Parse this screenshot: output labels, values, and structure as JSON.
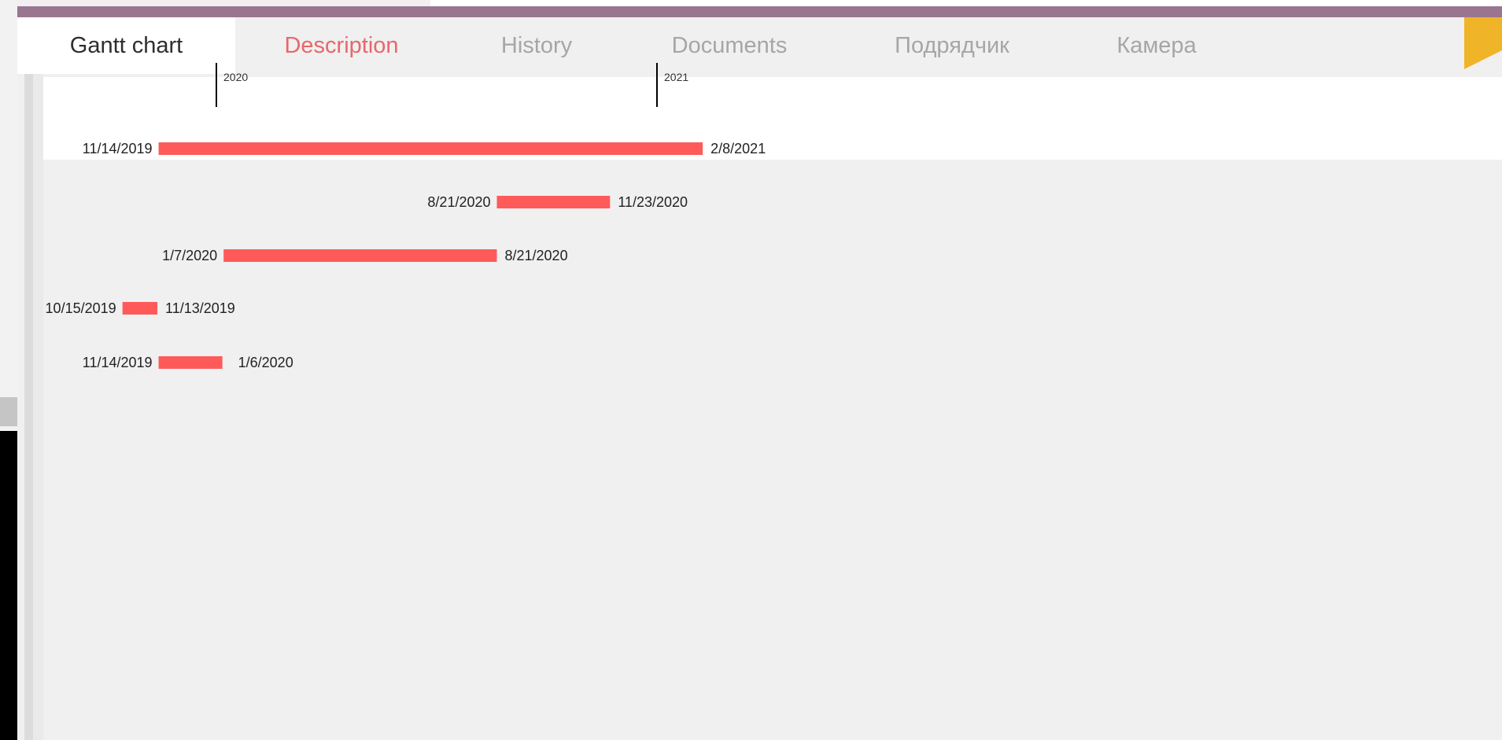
{
  "tabs": [
    {
      "label": "Gantt chart",
      "state": "active"
    },
    {
      "label": "Description",
      "state": "highlighted"
    },
    {
      "label": "History",
      "state": "normal"
    },
    {
      "label": "Documents",
      "state": "normal"
    },
    {
      "label": "Подрядчик",
      "state": "normal"
    },
    {
      "label": "Камера",
      "state": "normal"
    }
  ],
  "colors": {
    "bar": "#ff5a5a",
    "accent_bar": "#9a7590",
    "active_tab_text": "#2e2e2e",
    "highlight_tab_text": "#e8676b",
    "inactive_tab_text": "#a6a6a6",
    "corner_badge": "#f0b429"
  },
  "icons": {
    "corner": "corner-triangle-badge-icon"
  },
  "chart_data": {
    "type": "gantt",
    "axis_ticks": [
      "2020",
      "2021"
    ],
    "tasks": [
      {
        "start": "11/14/2019",
        "end": "2/8/2021"
      },
      {
        "start": "8/21/2020",
        "end": "11/23/2020"
      },
      {
        "start": "1/7/2020",
        "end": "8/21/2020"
      },
      {
        "start": "10/15/2019",
        "end": "11/13/2019"
      },
      {
        "start": "11/14/2019",
        "end": "1/6/2020"
      }
    ]
  }
}
